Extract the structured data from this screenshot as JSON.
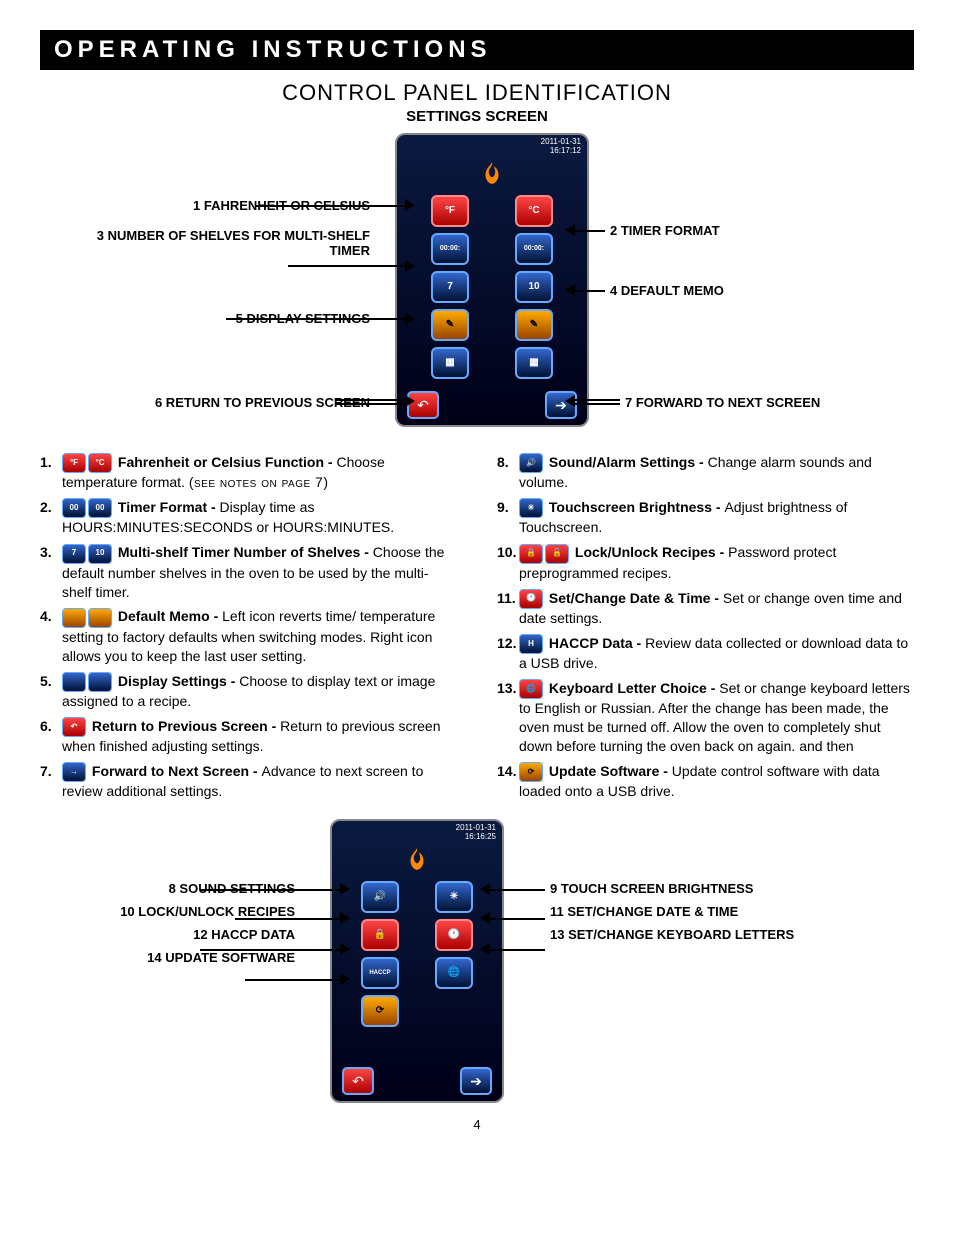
{
  "header_bar": "OPERATING INSTRUCTIONS",
  "title": "CONTROL PANEL IDENTIFICATION",
  "subtitle": "SETTINGS SCREEN",
  "page_number": "4",
  "screen1": {
    "date": "2011-01-31",
    "time": "16:17:12",
    "icons": {
      "f": "°F",
      "c": "°C",
      "t1": "00:00:",
      "t2": "00:00:",
      "s7": "7",
      "s10": "10"
    }
  },
  "screen2": {
    "date": "2011-01-31",
    "time": "16:16:25",
    "haccp": "HACCP"
  },
  "callouts1": {
    "l1": "1 FAHRENHEIT OR CELSIUS",
    "l3": "3 NUMBER OF SHELVES FOR MULTI-SHELF TIMER",
    "l5": "5 DISPLAY SETTINGS",
    "l6": "6 RETURN TO PREVIOUS SCREEN",
    "r2": "2 TIMER FORMAT",
    "r4": "4 DEFAULT MEMO",
    "r7": "7 FORWARD TO NEXT SCREEN"
  },
  "callouts2": {
    "l8": "8 SOUND SETTINGS",
    "l10": "10 LOCK/UNLOCK RECIPES",
    "l12": "12 HACCP DATA",
    "l14": "14 UPDATE SOFTWARE",
    "r9": "9 TOUCH SCREEN BRIGHTNESS",
    "r11": "11 SET/CHANGE DATE & TIME",
    "r13": "13 SET/CHANGE KEYBOARD LETTERS"
  },
  "list": [
    {
      "n": "1.",
      "t": "Fahrenheit or Celsius Function - ",
      "b": "Choose temperature format. ",
      "note": "(see notes on page 7)",
      "ic": [
        "red:°F",
        "red:°C"
      ]
    },
    {
      "n": "2.",
      "t": "Timer Format - ",
      "b": "Display time as HOURS:MINUTES:SECONDS or HOURS:MINUTES.",
      "ic": [
        "blue:00:00:",
        "blue:00:00:"
      ]
    },
    {
      "n": "3.",
      "t": "Multi-shelf Timer Number of Shelves - ",
      "b": "Choose the default number shelves in the oven to be used by the multi-shelf timer.",
      "ic": [
        "blue:7",
        "blue:10"
      ]
    },
    {
      "n": "4.",
      "t": "Default Memo - ",
      "b": "Left icon reverts time/ temperature setting to factory defaults when switching modes. Right icon allows you to keep the last user setting.",
      "ic": [
        "amber:",
        "amber:"
      ]
    },
    {
      "n": "5.",
      "t": "Display Settings - ",
      "b": "Choose to display text or image assigned to a recipe.",
      "ic": [
        "blue:",
        "blue:"
      ]
    },
    {
      "n": "6.",
      "t": "Return to Previous Screen - ",
      "b": "Return to previous screen when finished adjusting settings.",
      "ic": [
        "red:↶"
      ]
    },
    {
      "n": "7.",
      "t": "Forward to Next Screen - ",
      "b": "Advance to next screen to review additional settings.",
      "ic": [
        "blue:→"
      ]
    },
    {
      "n": "8.",
      "t": "Sound/Alarm Settings - ",
      "b": "Change alarm sounds and volume.",
      "ic": [
        "blue:🔊"
      ]
    },
    {
      "n": "9.",
      "t": "Touchscreen Brightness - ",
      "b": "Adjust brightness of Touchscreen.",
      "ic": [
        "blue:☀"
      ]
    },
    {
      "n": "10.",
      "t": "Lock/Unlock Recipes - ",
      "b": "Password protect preprogrammed recipes.",
      "ic": [
        "red:🔒",
        "red:🔓"
      ]
    },
    {
      "n": "11.",
      "t": "Set/Change Date & Time - ",
      "b": "Set or change oven time and date settings.",
      "ic": [
        "red:🕐"
      ]
    },
    {
      "n": "12.",
      "t": "HACCP Data - ",
      "b": "Review data collected or download data to a USB drive.",
      "ic": [
        "blue:H"
      ]
    },
    {
      "n": "13.",
      "t": "Keyboard Letter Choice - ",
      "b": "Set or change keyboard letters to English or Russian. After the change has been made, the oven must be turned off. Allow the oven to completely shut down before turning the oven back on again. and then",
      "ic": [
        "red:🌐"
      ]
    },
    {
      "n": "14.",
      "t": "Update Software - ",
      "b": "Update control software with data loaded onto a USB drive.",
      "ic": [
        "amber:⟳"
      ]
    }
  ]
}
